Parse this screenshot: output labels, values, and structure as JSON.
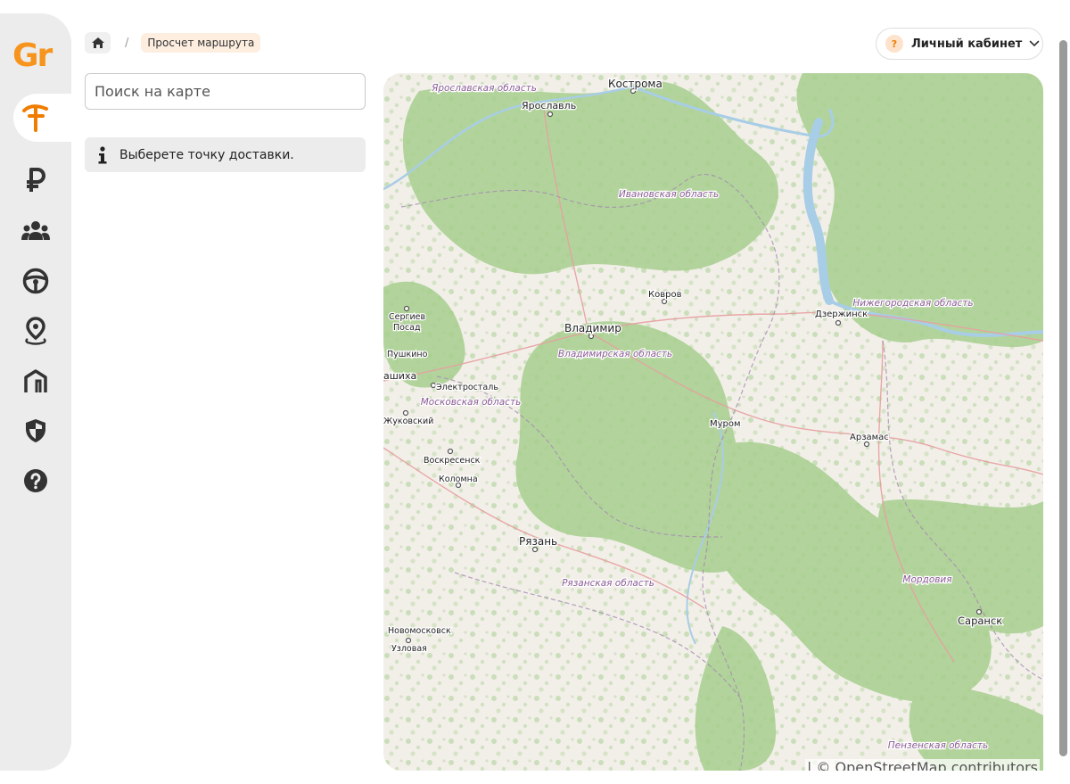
{
  "sidebar": {
    "logo": "Gr",
    "accent": "#f7941d",
    "items": [
      {
        "icon": "route-icon",
        "active": true
      },
      {
        "icon": "ruble-icon"
      },
      {
        "icon": "users-icon"
      },
      {
        "icon": "steering-wheel-icon"
      },
      {
        "icon": "map-pin-icon"
      },
      {
        "icon": "warehouse-icon"
      },
      {
        "icon": "shield-icon"
      },
      {
        "icon": "help-icon"
      }
    ]
  },
  "header": {
    "breadcrumb": {
      "home_icon": "home-icon",
      "separator": "/",
      "current": "Просчет маршрута"
    },
    "account": {
      "badge": "?",
      "label": "Личный кабинет",
      "chevron_icon": "chevron-down-icon"
    }
  },
  "panel": {
    "search_placeholder": "Поиск на карте",
    "info_icon": "info-icon",
    "info_text": "Выберете точку доставки."
  },
  "map": {
    "attribution": "| © OpenStreetMap contributors",
    "cities": [
      {
        "name": "Кострома"
      },
      {
        "name": "Ярославль"
      },
      {
        "name": "Ковров"
      },
      {
        "name": "Владимир"
      },
      {
        "name": "Дзержинск"
      },
      {
        "name": "Сергиев"
      },
      {
        "name": "Посад"
      },
      {
        "name": "Пушкино"
      },
      {
        "name": "ашиха"
      },
      {
        "name": "Электросталь"
      },
      {
        "name": "Жуковский"
      },
      {
        "name": "Муром"
      },
      {
        "name": "Арзамас"
      },
      {
        "name": "Воскресенск"
      },
      {
        "name": "Коломна"
      },
      {
        "name": "Рязань"
      },
      {
        "name": "Новомосковск"
      },
      {
        "name": "Узловая"
      },
      {
        "name": "Саранск"
      }
    ],
    "regions": [
      {
        "name": "Ярославская область"
      },
      {
        "name": "Ивановская область"
      },
      {
        "name": "Нижегородская область"
      },
      {
        "name": "Владимирская область"
      },
      {
        "name": "Московская область"
      },
      {
        "name": "Рязанская область"
      },
      {
        "name": "Мордовия"
      },
      {
        "name": "Пензенская область"
      }
    ]
  }
}
